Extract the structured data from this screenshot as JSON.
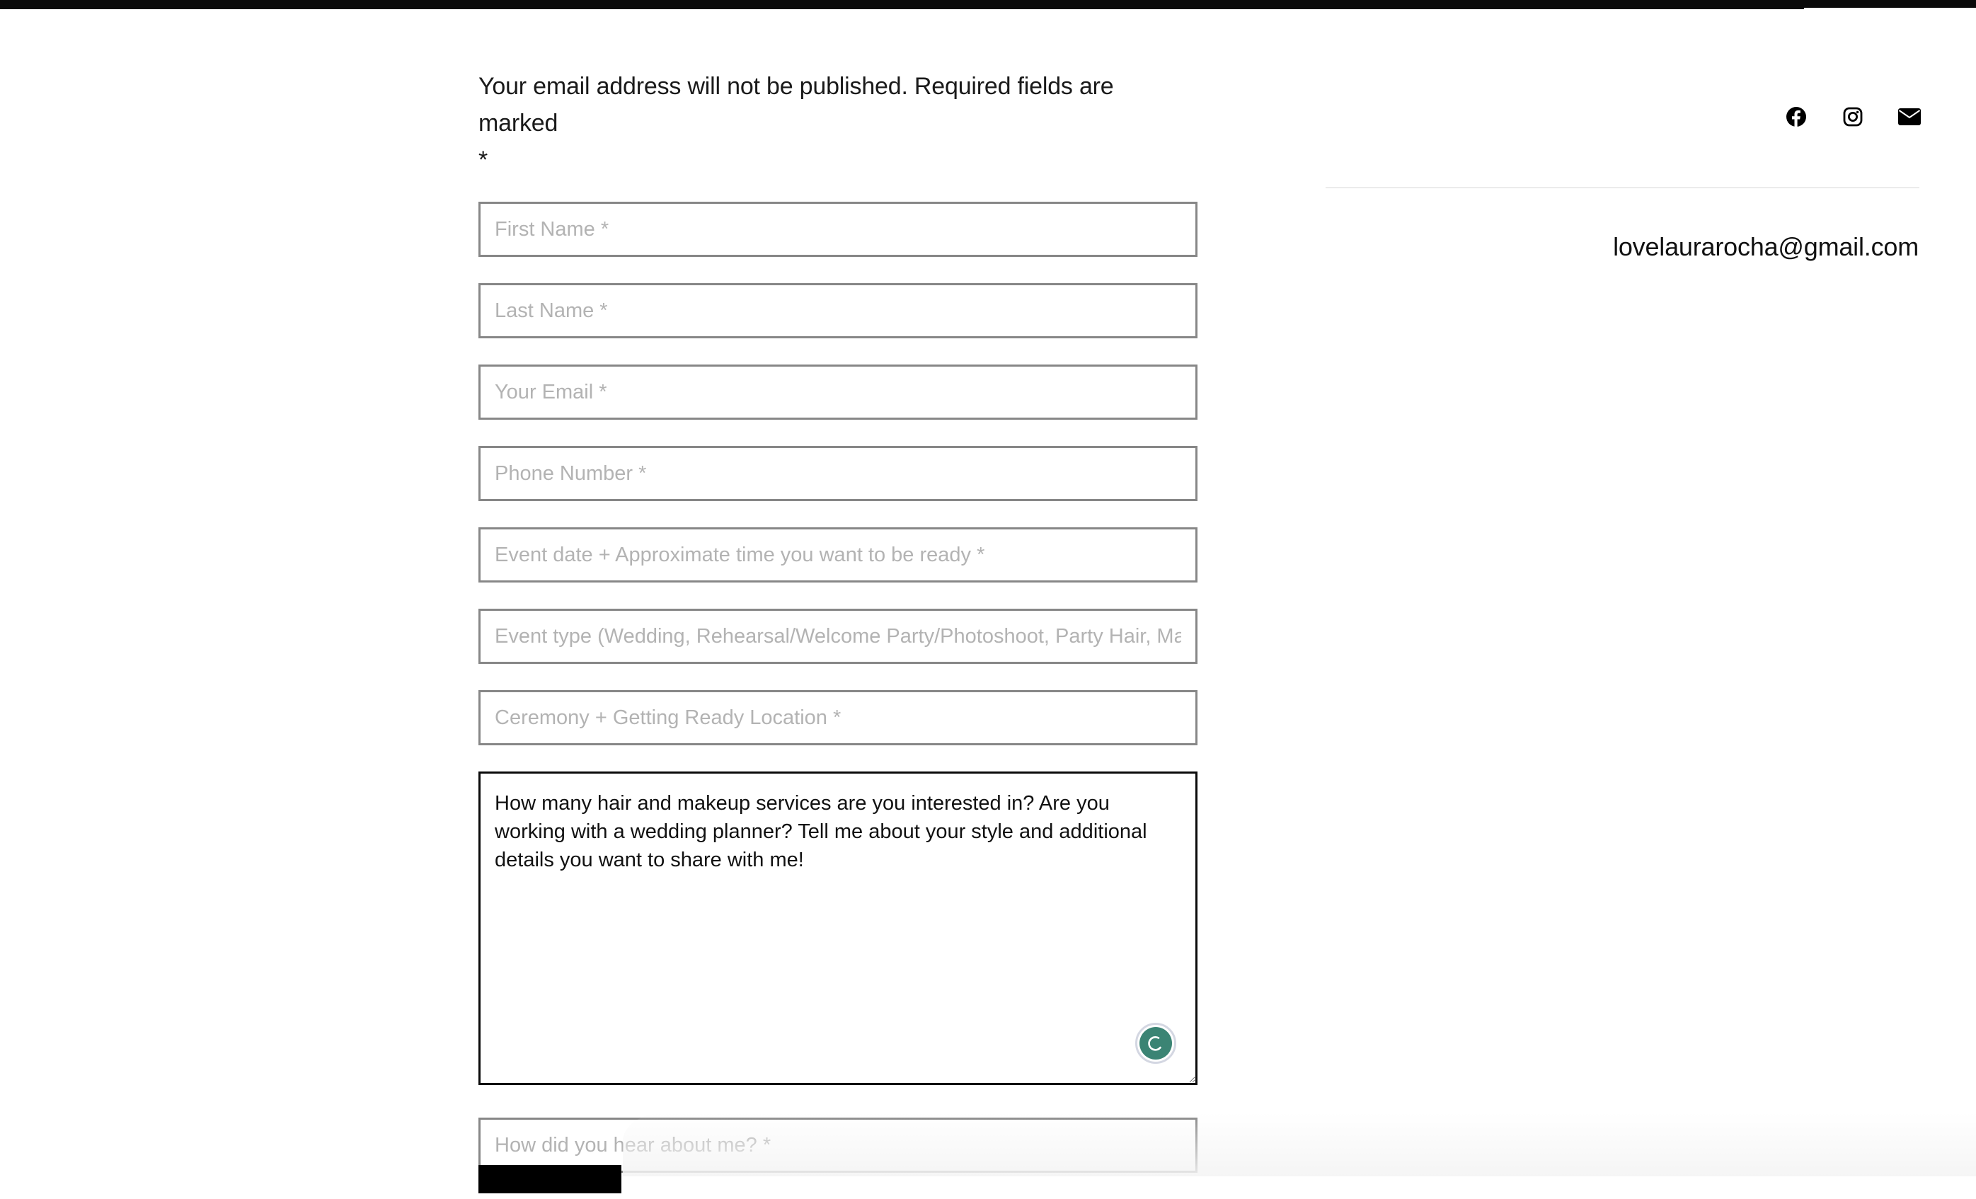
{
  "page": {
    "scroll_progress_percent": 91.3
  },
  "form": {
    "notice_line1": "Your email address will not be published. Required fields are marked",
    "notice_line2": "*",
    "fields": [
      {
        "name": "first-name",
        "placeholder": "First Name *",
        "value": ""
      },
      {
        "name": "last-name",
        "placeholder": "Last Name *",
        "value": ""
      },
      {
        "name": "email",
        "placeholder": "Your Email *",
        "value": ""
      },
      {
        "name": "phone",
        "placeholder": "Phone Number *",
        "value": ""
      },
      {
        "name": "event-date",
        "placeholder": "Event date + Approximate time you want to be ready *",
        "value": ""
      },
      {
        "name": "event-type",
        "placeholder": "Event type (Wedding, Rehearsal/Welcome Party/Photoshoot, Party Hair, Makeup *",
        "value": ""
      },
      {
        "name": "location",
        "placeholder": "Ceremony + Getting Ready Location *",
        "value": ""
      }
    ],
    "message": {
      "placeholder": "How many hair and makeup services are you interested in? Are you working with a wedding planner? Tell me about your style and additional details you want to share with me!",
      "value": ""
    },
    "referral": {
      "placeholder": "How did you hear about me? *",
      "value": ""
    },
    "submit_label": "",
    "grammar_badge_color": "#3b8474"
  },
  "sidebar": {
    "social": [
      {
        "icon": "facebook-icon",
        "label": "Facebook"
      },
      {
        "icon": "instagram-icon",
        "label": "Instagram"
      },
      {
        "icon": "mail-icon",
        "label": "Email"
      }
    ],
    "contact_email": "lovelaurarocha@gmail.com"
  }
}
